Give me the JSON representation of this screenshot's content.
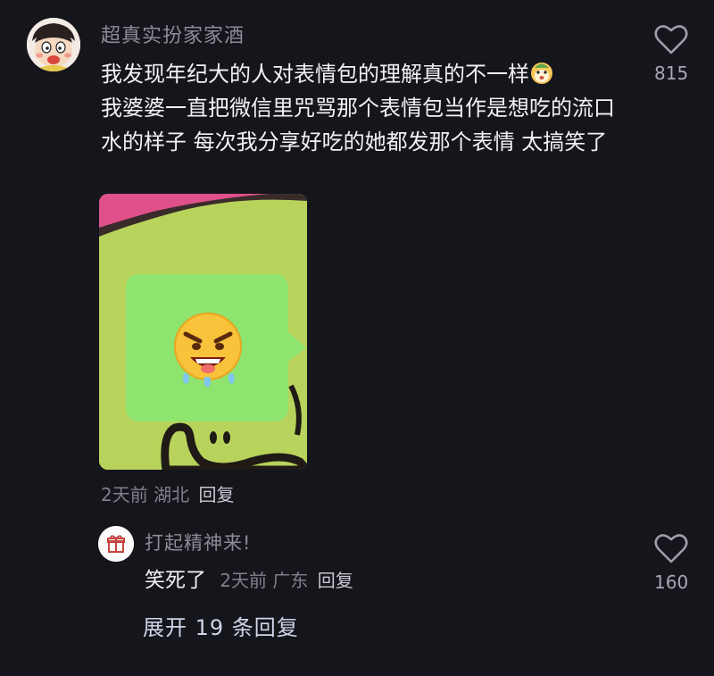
{
  "comment": {
    "username": "超真实扮家家酒",
    "text": "我发现年纪大的人对表情包的理解真的不一样",
    "text_rest": "\n我婆婆一直把微信里咒骂那个表情包当作是想吃的流口水的样子 每次我分享好吃的她都发那个表情 太搞笑了",
    "inline_emoji": "mascot-emoji-icon",
    "time": "2天前",
    "location": "湖北",
    "reply_label": "回复",
    "likes": "815"
  },
  "reply": {
    "username": "打起精神来!",
    "text": "笑死了",
    "time": "2天前",
    "location": "广东",
    "reply_label": "回复",
    "likes": "160"
  },
  "expand_label": "展开 19 条回复",
  "colors": {
    "background": "#15151c",
    "image_green": "#b9d55d",
    "bubble_green": "#8fe36f"
  }
}
